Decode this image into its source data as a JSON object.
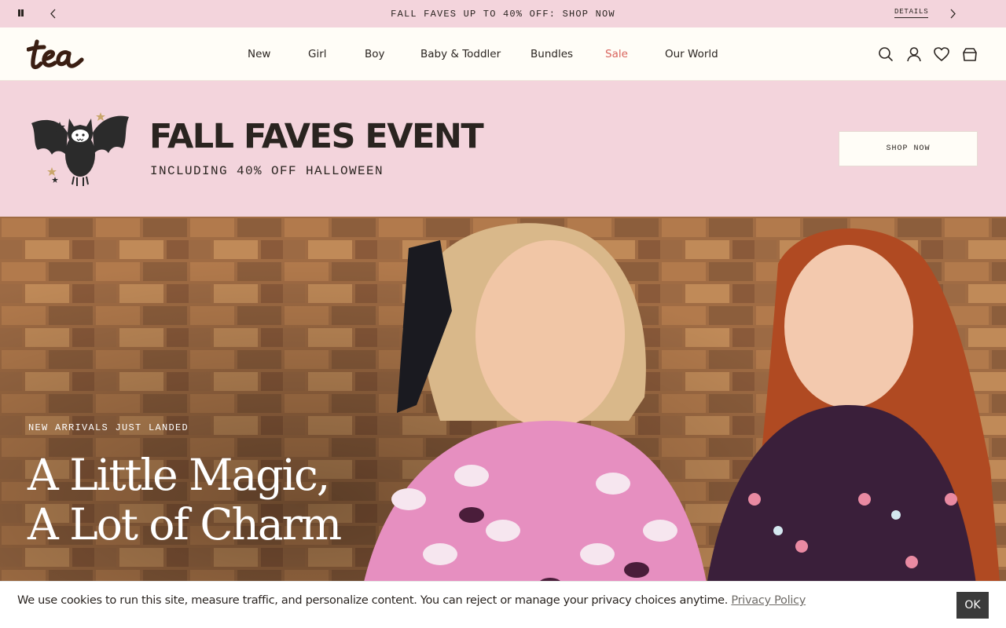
{
  "announcement": {
    "message": "FALL FAVES UP TO 40% OFF: SHOP NOW",
    "details_label": "DETAILS"
  },
  "header": {
    "logo_text": "tea",
    "nav": [
      {
        "label": "New"
      },
      {
        "label": "Girl"
      },
      {
        "label": "Boy"
      },
      {
        "label": "Baby & Toddler"
      },
      {
        "label": "Bundles"
      },
      {
        "label": "Sale"
      },
      {
        "label": "Our World"
      }
    ],
    "icons": [
      "search-icon",
      "account-icon",
      "wishlist-heart-icon",
      "bag-icon"
    ]
  },
  "promo": {
    "title": "FALL FAVES EVENT",
    "subtitle": "INCLUDING 40% OFF HALLOWEEN",
    "button_label": "SHOP NOW"
  },
  "hero": {
    "eyebrow": "NEW ARRIVALS JUST LANDED",
    "title_line1": "A Little Magic,",
    "title_line2": "A Lot of Charm"
  },
  "cookie": {
    "text": "We use cookies to run this site, measure traffic, and personalize content. You can reject or manage your privacy choices anytime.",
    "link_label": "Privacy Policy",
    "ok_label": "OK"
  },
  "colors": {
    "pink_bg": "#f3d4dc",
    "cream_bg": "#fffdf7",
    "text_dark": "#2a2420",
    "sale_red": "#d9645d",
    "ok_button": "#3a3a3a"
  }
}
